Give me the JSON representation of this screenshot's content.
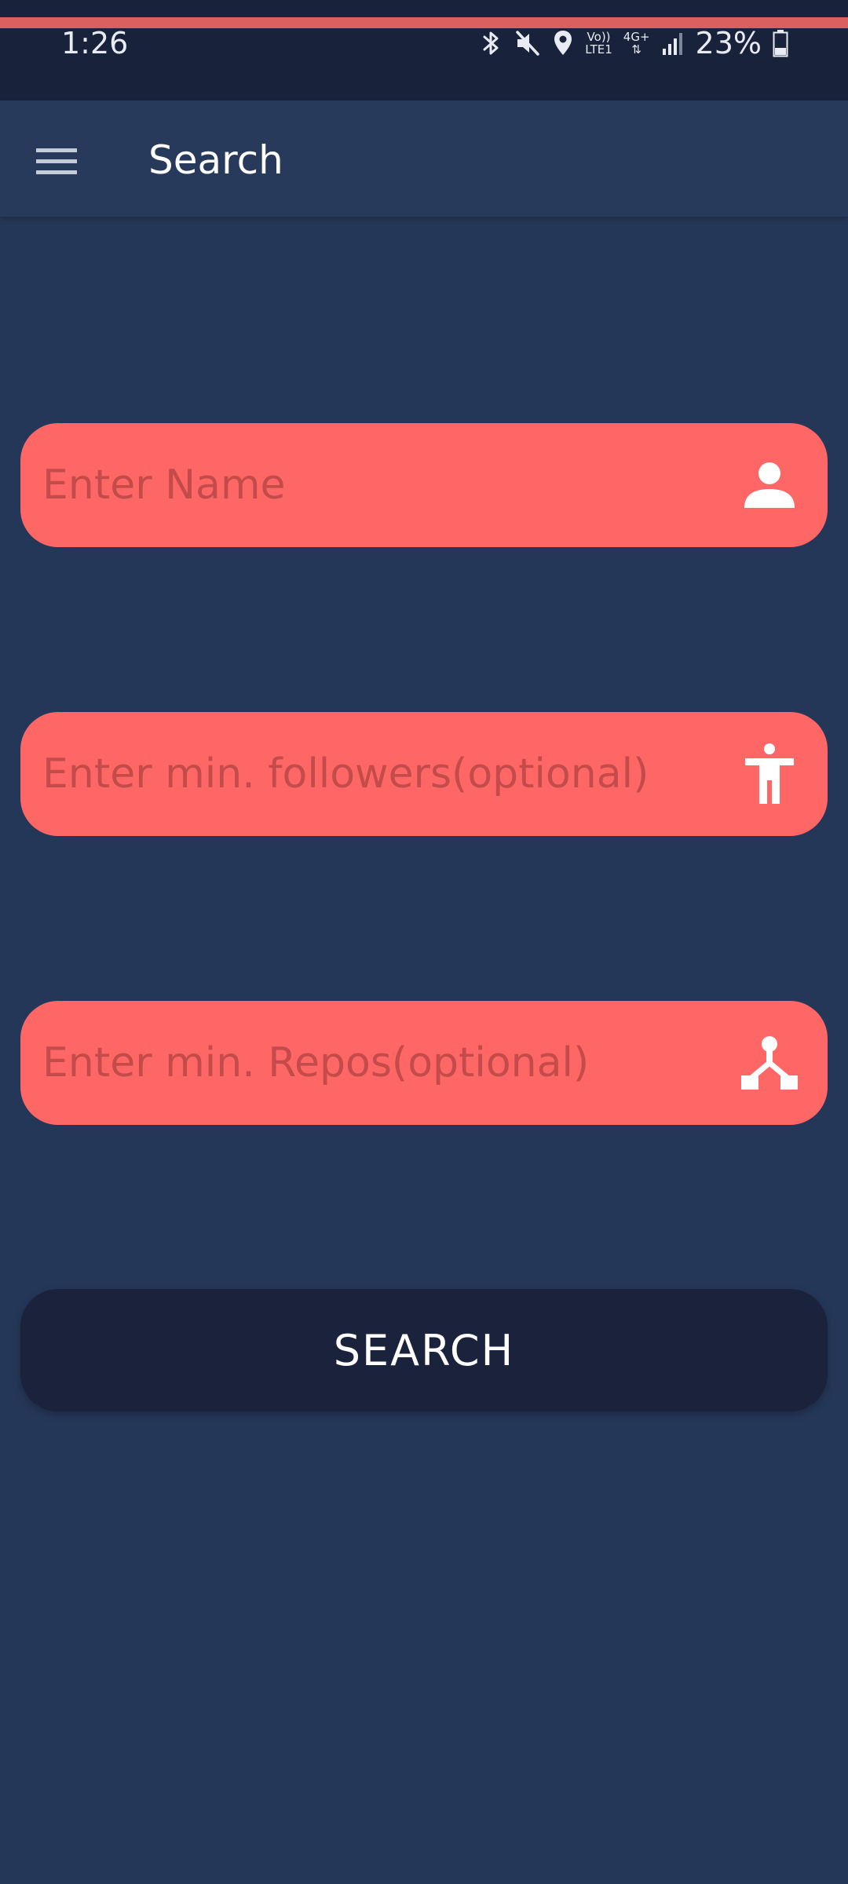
{
  "status_bar": {
    "time": "1:26",
    "network_top": "Vo))",
    "network_bottom": "LTE1",
    "data_type": "4G+",
    "battery": "23%"
  },
  "app_bar": {
    "title": "Search"
  },
  "form": {
    "name_placeholder": "Enter Name",
    "followers_placeholder": "Enter min. followers(optional)",
    "repos_placeholder": "Enter min. Repos(optional)",
    "search_label": "SEARCH"
  },
  "colors": {
    "background": "#253758",
    "status_bar": "#18223b",
    "app_bar": "#273a5b",
    "field": "#ff6666",
    "placeholder": "#c34b4a",
    "button": "#1a233b",
    "accent_strip": "#d9605f"
  },
  "icons": {
    "menu": "hamburger-menu-icon",
    "name": "person-icon",
    "followers": "accessibility-icon",
    "repos": "fork-icon"
  }
}
